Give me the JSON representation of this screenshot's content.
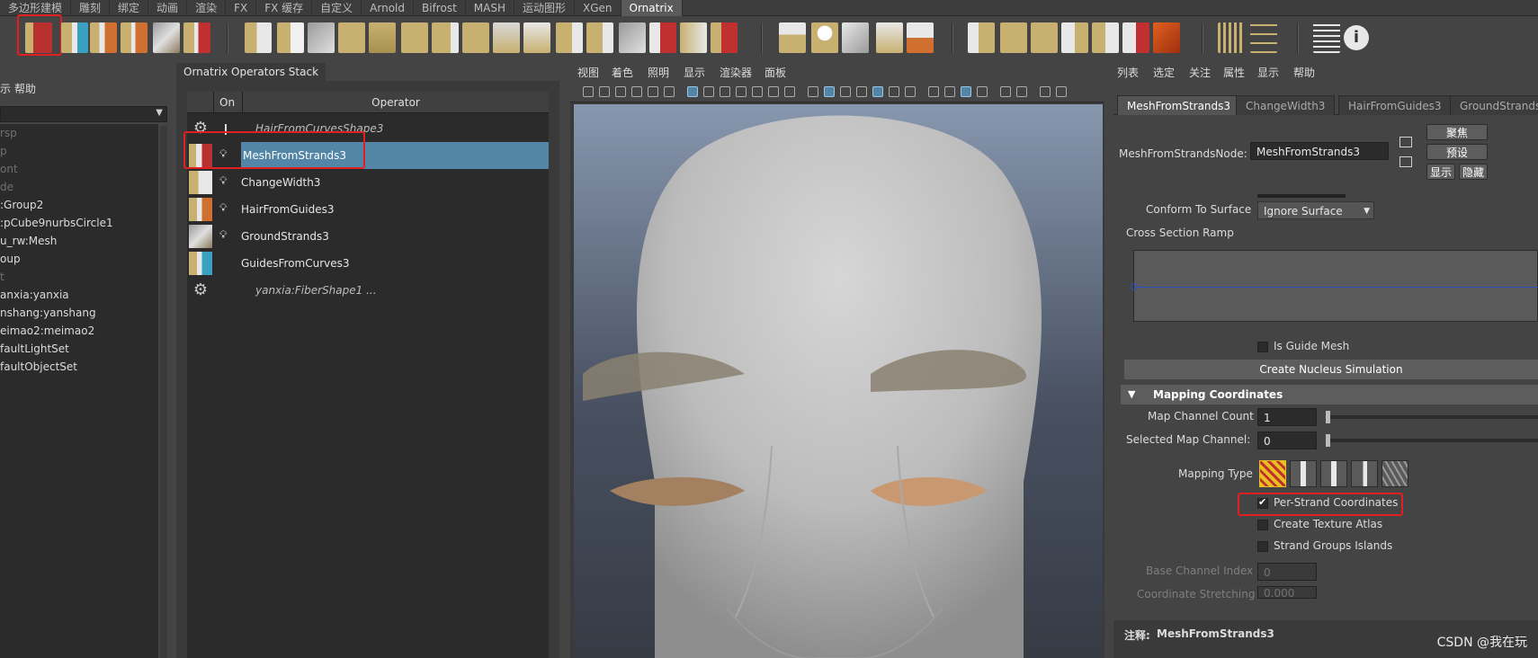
{
  "shelf": {
    "tabs": [
      "多边形建模",
      "雕刻",
      "绑定",
      "动画",
      "渲染",
      "FX",
      "FX 缓存",
      "自定义",
      "Arnold",
      "Bifrost",
      "MASH",
      "运动图形",
      "XGen",
      "Ornatrix"
    ],
    "active_tab": "Ornatrix"
  },
  "outliner": {
    "menu": [
      "示",
      "帮助"
    ],
    "rows": [
      {
        "text": "rsp",
        "dim": true
      },
      {
        "text": "p",
        "dim": true
      },
      {
        "text": "ont",
        "dim": true
      },
      {
        "text": "de",
        "dim": true
      },
      {
        "text": ":Group2",
        "dim": false
      },
      {
        "text": ":pCube9nurbsCircle1",
        "dim": false
      },
      {
        "text": "u_rw:Mesh",
        "dim": false
      },
      {
        "text": "oup",
        "dim": false
      },
      {
        "text": "t",
        "dim": true
      },
      {
        "text": "anxia:yanxia",
        "dim": false
      },
      {
        "text": "nshang:yanshang",
        "dim": false
      },
      {
        "text": "eimao2:meimao2",
        "dim": false
      },
      {
        "text": "faultLightSet",
        "dim": false
      },
      {
        "text": "faultObjectSet",
        "dim": false
      }
    ]
  },
  "ornatrix": {
    "title": "Ornatrix Operators Stack",
    "headers": {
      "on": "On",
      "operator": "Operator"
    },
    "rows": [
      {
        "label": "HairFromCurvesShape3",
        "italic": true,
        "selected": false
      },
      {
        "label": "MeshFromStrands3",
        "italic": false,
        "selected": true
      },
      {
        "label": "ChangeWidth3",
        "italic": false,
        "selected": false
      },
      {
        "label": "HairFromGuides3",
        "italic": false,
        "selected": false
      },
      {
        "label": "GroundStrands3",
        "italic": false,
        "selected": false
      },
      {
        "label": "GuidesFromCurves3",
        "italic": false,
        "selected": false
      },
      {
        "label": "yanxia:FiberShape1 ...",
        "italic": true,
        "selected": false
      }
    ]
  },
  "viewport": {
    "menu": [
      "视图",
      "着色",
      "照明",
      "显示",
      "渲染器",
      "面板"
    ]
  },
  "attribute_editor": {
    "menu": [
      "列表",
      "选定",
      "关注",
      "属性",
      "显示",
      "帮助"
    ],
    "tabs": [
      "MeshFromStrands3",
      "ChangeWidth3",
      "HairFromGuides3",
      "GroundStrands"
    ],
    "node_label": "MeshFromStrandsNode:",
    "node_value": "MeshFromStrands3",
    "buttons": {
      "focus": "聚焦",
      "preset": "预设",
      "show": "显示",
      "hide": "隐藏"
    },
    "conform_label": "Conform To Surface",
    "conform_value": "Ignore Surface",
    "ramp_label": "Cross Section Ramp",
    "is_guide_mesh": "Is Guide Mesh",
    "nucleus_button": "Create Nucleus Simulation",
    "section_mapping": "Mapping Coordinates",
    "map_channel_count_label": "Map Channel Count",
    "map_channel_count": "1",
    "selected_map_channel_label": "Selected Map Channel:",
    "selected_map_channel": "0",
    "mapping_type_label": "Mapping Type",
    "per_strand": "Per-Strand Coordinates",
    "texture_atlas": "Create Texture Atlas",
    "strand_groups": "Strand Groups Islands",
    "base_channel_label": "Base Channel Index",
    "base_channel_value": "0",
    "coord_stretch_label": "Coordinate Stretching",
    "coord_stretch_value": "0.000",
    "note_label": "注释:",
    "note_value": "MeshFromStrands3"
  },
  "watermark": "CSDN @我在玩",
  "colors": {
    "selection": "#5285a6",
    "highlight_box": "#e02020",
    "accent_yellow": "#e8c020"
  }
}
